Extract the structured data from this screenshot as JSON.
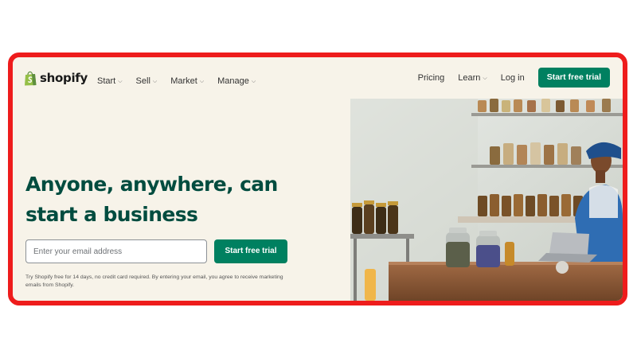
{
  "brand": {
    "name": "shopify"
  },
  "nav": {
    "menu": [
      {
        "label": "Start",
        "icon": "chevron-down-icon"
      },
      {
        "label": "Sell",
        "icon": "chevron-down-icon"
      },
      {
        "label": "Market",
        "icon": "chevron-down-icon"
      },
      {
        "label": "Manage",
        "icon": "chevron-down-icon"
      }
    ],
    "pricing": "Pricing",
    "learn": "Learn",
    "login": "Log in",
    "cta": "Start free trial"
  },
  "hero": {
    "title_line1": "Anyone, anywhere, can",
    "title_line2": "start a business",
    "email_placeholder": "Enter your email address",
    "cta": "Start free trial",
    "disclaimer": "Try Shopify free for 14 days, no credit card required. By entering your email, you agree to receive marketing emails from Shopify."
  },
  "colors": {
    "border": "#ee1c1c",
    "background": "#f7f3e9",
    "primary": "#008060",
    "headline": "#004c3f"
  }
}
